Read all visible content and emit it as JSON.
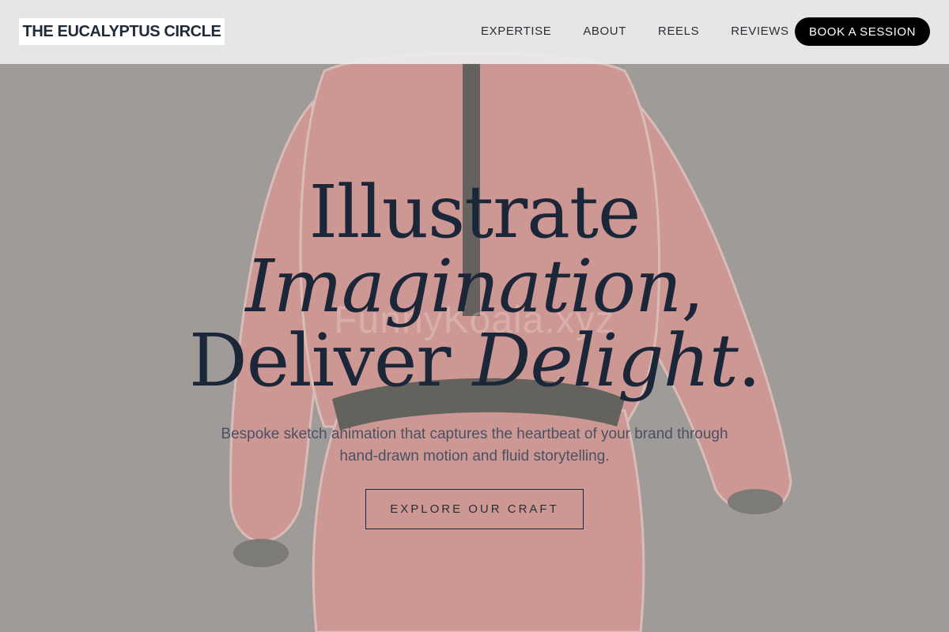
{
  "brand": {
    "name": "THE EUCALYPTUS CIRCLE"
  },
  "nav": {
    "links": [
      "EXPERTISE",
      "ABOUT",
      "REELS",
      "REVIEWS"
    ],
    "cta_label": "BOOK A SESSION"
  },
  "hero": {
    "headline_line1": "Illustrate",
    "headline_line2_italic": "Imagination",
    "headline_line2_tail": ",",
    "headline_line3_regular": "Deliver ",
    "headline_line3_italic": "Delight",
    "headline_line3_tail": ".",
    "subtitle": "Bespoke sketch animation that captures the heartbeat of your brand through hand-drawn motion and fluid storytelling.",
    "cta_label": "EXPLORE OUR CRAFT",
    "watermark": "FunnyKoala.xyz"
  },
  "colors": {
    "heading": "#1b2638",
    "body_text": "#4a5162",
    "button_bg": "#000000",
    "button_text": "#ffffff",
    "nav_bg": "#ececec",
    "figure": "#e0908a"
  }
}
